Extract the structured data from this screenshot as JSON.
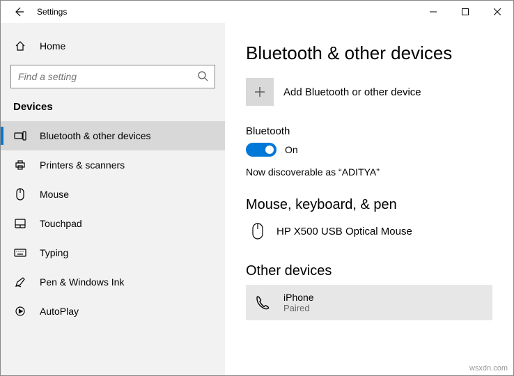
{
  "titlebar": {
    "title": "Settings"
  },
  "sidebar": {
    "home_label": "Home",
    "search_placeholder": "Find a setting",
    "group_label": "Devices",
    "items": [
      {
        "label": "Bluetooth & other devices"
      },
      {
        "label": "Printers & scanners"
      },
      {
        "label": "Mouse"
      },
      {
        "label": "Touchpad"
      },
      {
        "label": "Typing"
      },
      {
        "label": "Pen & Windows Ink"
      },
      {
        "label": "AutoPlay"
      }
    ]
  },
  "main": {
    "page_title": "Bluetooth & other devices",
    "add_label": "Add Bluetooth or other device",
    "bluetooth_label": "Bluetooth",
    "toggle_state": "On",
    "discoverable_text": "Now discoverable as “ADITYA”",
    "section_mouse": "Mouse, keyboard, & pen",
    "mouse_device": "HP X500 USB Optical Mouse",
    "section_other": "Other devices",
    "other_device": {
      "name": "iPhone",
      "status": "Paired"
    }
  },
  "watermark": "wsxdn.com"
}
